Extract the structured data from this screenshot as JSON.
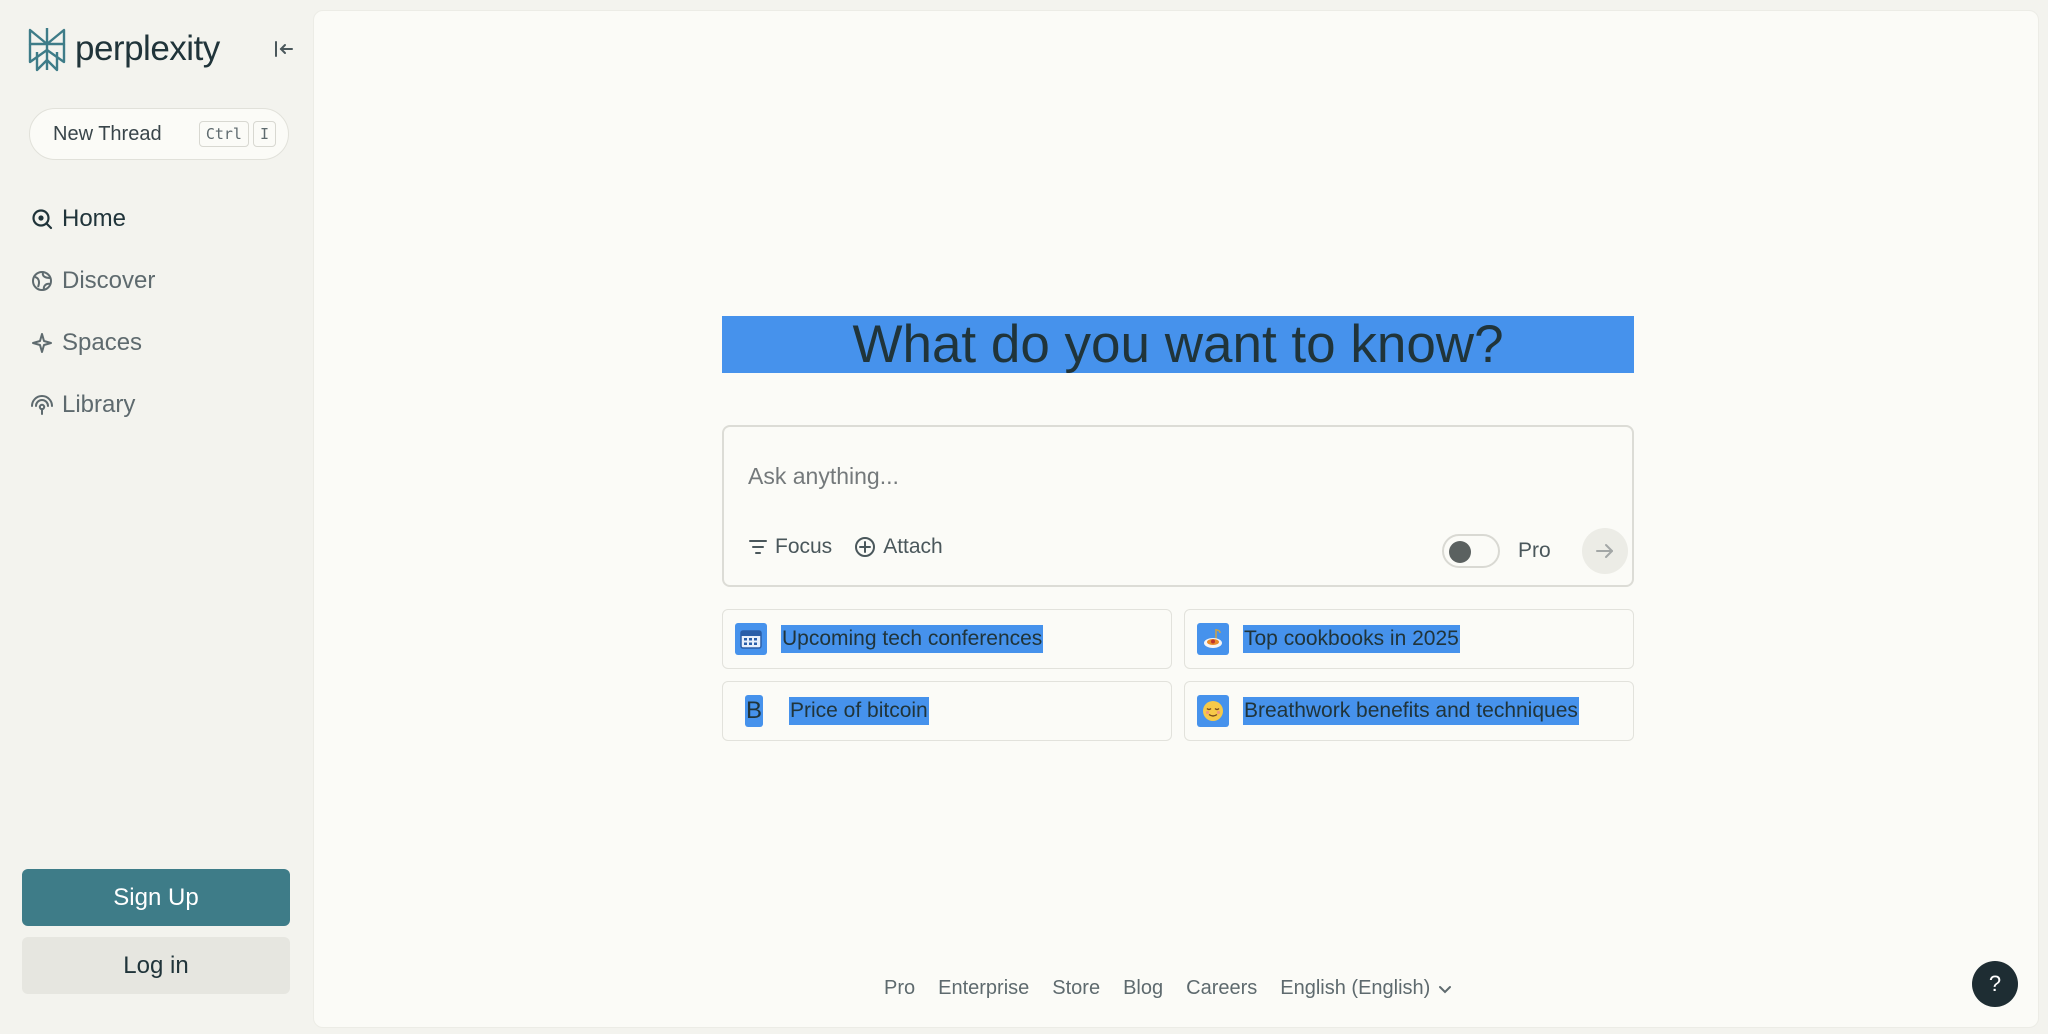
{
  "brand": {
    "name": "perplexity"
  },
  "sidebar": {
    "new_thread": {
      "label": "New Thread",
      "shortcut": [
        "Ctrl",
        "I"
      ]
    },
    "items": [
      {
        "label": "Home",
        "icon": "home-search-icon",
        "active": true
      },
      {
        "label": "Discover",
        "icon": "globe-icon"
      },
      {
        "label": "Spaces",
        "icon": "sparkle-icon"
      },
      {
        "label": "Library",
        "icon": "library-icon"
      }
    ],
    "signup_label": "Sign Up",
    "login_label": "Log in"
  },
  "main": {
    "headline": "What do you want to know?",
    "ask": {
      "placeholder": "Ask anything...",
      "focus_label": "Focus",
      "attach_label": "Attach",
      "pro_label": "Pro",
      "pro_enabled": false
    },
    "suggestions": [
      {
        "label": "Upcoming tech conferences",
        "icon": "calendar-icon"
      },
      {
        "label": "Top cookbooks in 2025",
        "icon": "pasta-icon"
      },
      {
        "label": "Price of bitcoin",
        "icon": "bitcoin-icon",
        "glyph": "B"
      },
      {
        "label": "Breathwork benefits and techniques",
        "icon": "relieved-face-icon"
      }
    ]
  },
  "footer": {
    "links": [
      "Pro",
      "Enterprise",
      "Store",
      "Blog",
      "Careers"
    ],
    "language": "English (English)"
  },
  "help_label": "?",
  "colors": {
    "accent": "#3e7c88",
    "highlight": "#4692ec",
    "text": "#20343a",
    "sidebar_bg": "#f3f3ee",
    "panel_bg": "#fbfbf7"
  }
}
